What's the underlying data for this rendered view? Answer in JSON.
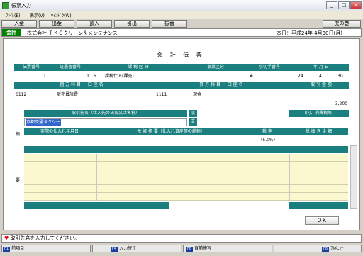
{
  "window": {
    "title": "伝票入力",
    "min": "_",
    "max": "□",
    "close": "×"
  },
  "menu": [
    "ﾌｧｲﾙ(E)",
    "表示(V)",
    "ｳｨﾝﾄﾞｳ(W)"
  ],
  "toolbar": {
    "items": [
      "入金",
      "出金",
      "預入",
      "引出",
      "振替"
    ],
    "help": "虎の巻"
  },
  "company": {
    "badge": "会計",
    "name": "株式会社 ＴＫＣクリーン＆メンテナンス",
    "date": "本日：平成24年 4月30日(月)"
  },
  "voucher": {
    "title": "会 計 伝 票",
    "headers": {
      "slip_no": "伝票番号",
      "evidence_no": "証憑書番号",
      "tax_class": "課 税 区 分",
      "business": "事業区分",
      "check_no": "小切手番号",
      "ymd": "年 月 日"
    },
    "values": {
      "slip_no": "1",
      "evidence_no": "1",
      "tax_code": "5",
      "tax_name": "課税仕入(課売)",
      "check_no": "#",
      "year": "24",
      "month": "4",
      "day": "30"
    },
    "account_headers": {
      "debit": "借 方 科 目 ・ 口 座 名",
      "credit": "貸 方 科 目 ・ 口 座 名",
      "amount": "取 引 金 額"
    },
    "debit": {
      "code": "6112",
      "name": "販売員旅費"
    },
    "credit": {
      "code": "1111",
      "name": "現金"
    },
    "amount": "3,200",
    "side_labels": {
      "top": "摘",
      "bottom": "要"
    },
    "partner_header": "取引先名（仕入先の氏名又は名称）",
    "ki": "収",
    "shi": "支",
    "partner_value": "京都交通タクシー",
    "tax_note": "(内、消費税等)",
    "detail_headers": {
      "date": "実際の仕入れ年月日",
      "summary": "元 帳 摘 要（仕入れ資産等の総称）",
      "rate": "税 率",
      "net": "税 抜 き 金 額"
    },
    "rate_value": "(5.0%)",
    "ok": "ＯＫ"
  },
  "status": {
    "icon": "heart-icon",
    "text": "取引先名を入力してください。"
  },
  "fkeys": [
    {
      "key": "F1",
      "label": "前項目"
    },
    {
      "key": "F4",
      "label": "入力終了"
    },
    {
      "key": "F6",
      "label": "直前摸写"
    },
    {
      "key": "F8",
      "label": "ﾌﾙﾒﾆｭｰ"
    }
  ],
  "colors": {
    "header": "#1b7f7f",
    "badge": "#008000",
    "grid": "#fbf8d0"
  }
}
